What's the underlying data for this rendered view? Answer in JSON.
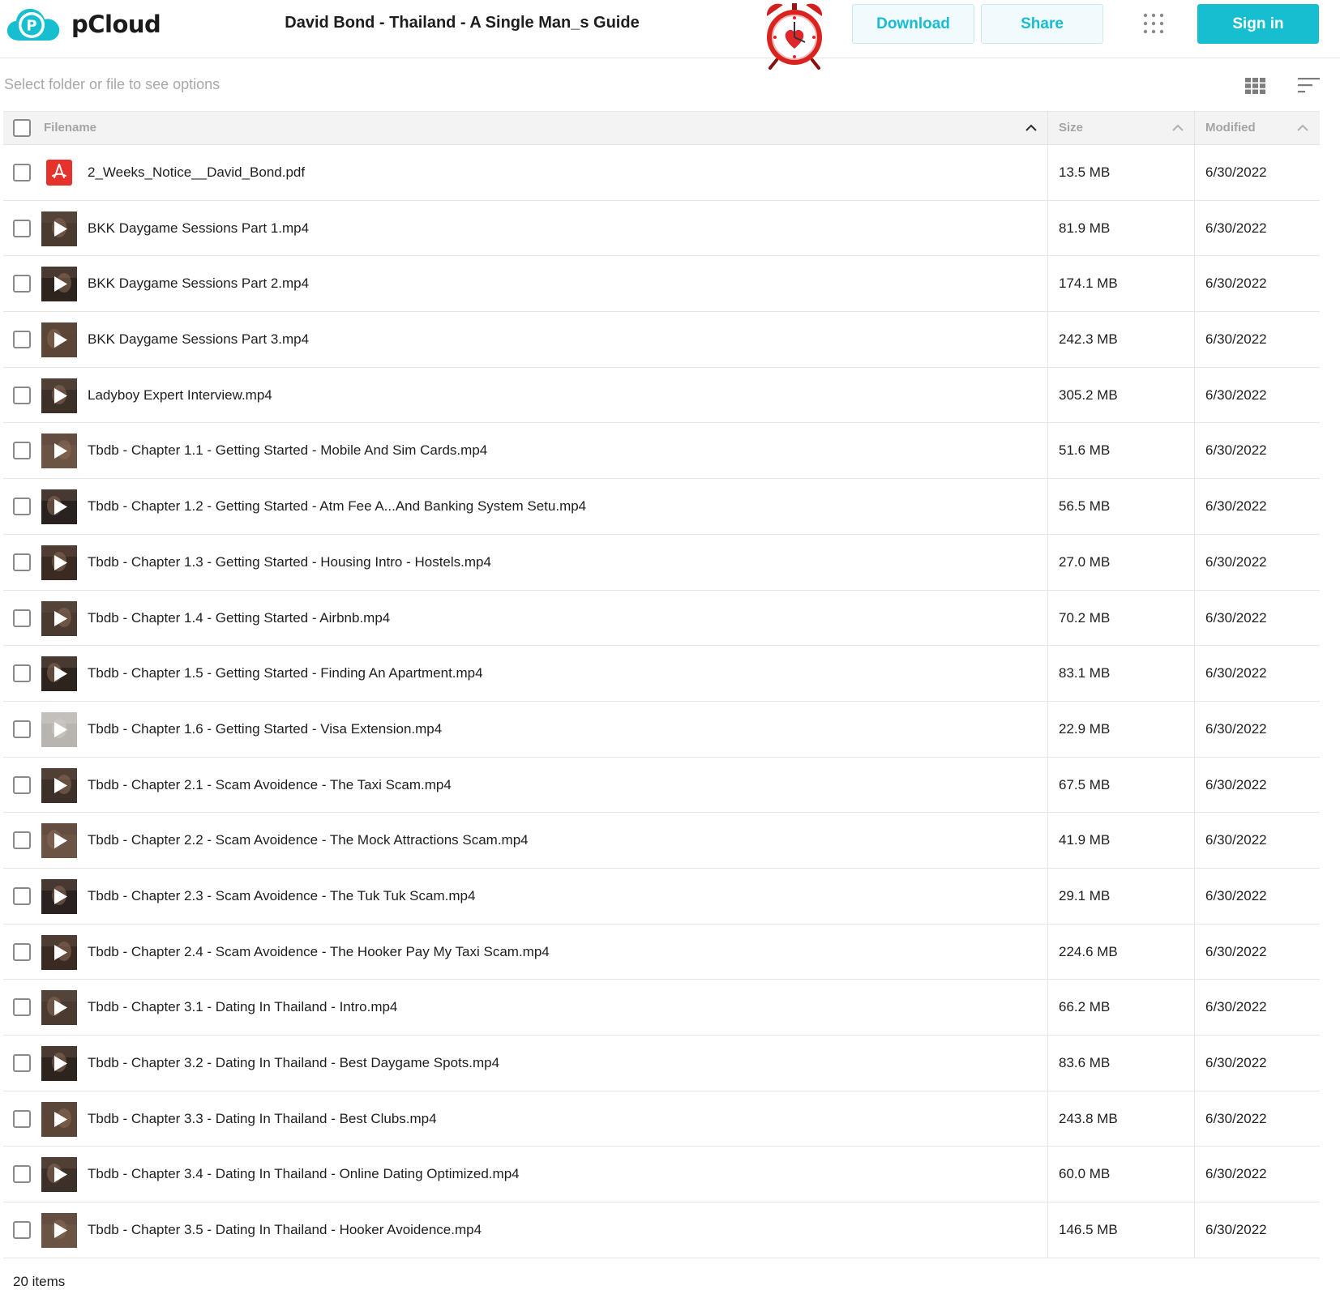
{
  "header": {
    "brand": "pCloud",
    "title": "David Bond - Thailand - A Single Man_s Guide",
    "download_label": "Download",
    "share_label": "Share",
    "signin_label": "Sign in",
    "accent_color": "#17bed0"
  },
  "toolbar": {
    "hint": "Select folder or file to see options",
    "view_icon": "grid-view-icon",
    "sort_icon": "sort-icon"
  },
  "table": {
    "columns": {
      "filename": "Filename",
      "size": "Size",
      "modified": "Modified"
    },
    "files": [
      {
        "name": "2_Weeks_Notice__David_Bond.pdf",
        "size": "13.5 MB",
        "modified": "6/30/2022",
        "type": "pdf"
      },
      {
        "name": "BKK Daygame Sessions Part 1.mp4",
        "size": "81.9 MB",
        "modified": "6/30/2022",
        "type": "video"
      },
      {
        "name": "BKK Daygame Sessions Part 2.mp4",
        "size": "174.1 MB",
        "modified": "6/30/2022",
        "type": "video"
      },
      {
        "name": "BKK Daygame Sessions Part 3.mp4",
        "size": "242.3 MB",
        "modified": "6/30/2022",
        "type": "video"
      },
      {
        "name": "Ladyboy Expert Interview.mp4",
        "size": "305.2 MB",
        "modified": "6/30/2022",
        "type": "video"
      },
      {
        "name": "Tbdb - Chapter 1.1 - Getting Started - Mobile And Sim Cards.mp4",
        "size": "51.6 MB",
        "modified": "6/30/2022",
        "type": "video"
      },
      {
        "name": "Tbdb - Chapter 1.2 - Getting Started - Atm Fee A...And Banking System Setu.mp4",
        "size": "56.5 MB",
        "modified": "6/30/2022",
        "type": "video"
      },
      {
        "name": "Tbdb - Chapter 1.3 - Getting Started - Housing Intro - Hostels.mp4",
        "size": "27.0 MB",
        "modified": "6/30/2022",
        "type": "video"
      },
      {
        "name": "Tbdb - Chapter 1.4 - Getting Started - Airbnb.mp4",
        "size": "70.2 MB",
        "modified": "6/30/2022",
        "type": "video"
      },
      {
        "name": "Tbdb - Chapter 1.5 - Getting Started - Finding An Apartment.mp4",
        "size": "83.1 MB",
        "modified": "6/30/2022",
        "type": "video"
      },
      {
        "name": "Tbdb - Chapter 1.6 - Getting Started - Visa Extension.mp4",
        "size": "22.9 MB",
        "modified": "6/30/2022",
        "type": "video-light"
      },
      {
        "name": "Tbdb - Chapter 2.1 - Scam Avoidence - The Taxi Scam.mp4",
        "size": "67.5 MB",
        "modified": "6/30/2022",
        "type": "video"
      },
      {
        "name": "Tbdb - Chapter 2.2 - Scam Avoidence - The Mock Attractions Scam.mp4",
        "size": "41.9 MB",
        "modified": "6/30/2022",
        "type": "video"
      },
      {
        "name": "Tbdb - Chapter 2.3 - Scam Avoidence - The Tuk Tuk Scam.mp4",
        "size": "29.1 MB",
        "modified": "6/30/2022",
        "type": "video"
      },
      {
        "name": "Tbdb - Chapter 2.4 - Scam Avoidence - The Hooker Pay My Taxi Scam.mp4",
        "size": "224.6 MB",
        "modified": "6/30/2022",
        "type": "video"
      },
      {
        "name": "Tbdb - Chapter 3.1 - Dating In Thailand - Intro.mp4",
        "size": "66.2 MB",
        "modified": "6/30/2022",
        "type": "video"
      },
      {
        "name": "Tbdb - Chapter 3.2 - Dating In Thailand - Best Daygame Spots.mp4",
        "size": "83.6 MB",
        "modified": "6/30/2022",
        "type": "video"
      },
      {
        "name": "Tbdb - Chapter 3.3 - Dating In Thailand - Best Clubs.mp4",
        "size": "243.8 MB",
        "modified": "6/30/2022",
        "type": "video"
      },
      {
        "name": "Tbdb - Chapter 3.4 - Dating In Thailand - Online Dating Optimized.mp4",
        "size": "60.0 MB",
        "modified": "6/30/2022",
        "type": "video"
      },
      {
        "name": "Tbdb - Chapter 3.5 - Dating In Thailand - Hooker Avoidence.mp4",
        "size": "146.5 MB",
        "modified": "6/30/2022",
        "type": "video"
      }
    ]
  },
  "footer": {
    "item_count": "20 items"
  }
}
